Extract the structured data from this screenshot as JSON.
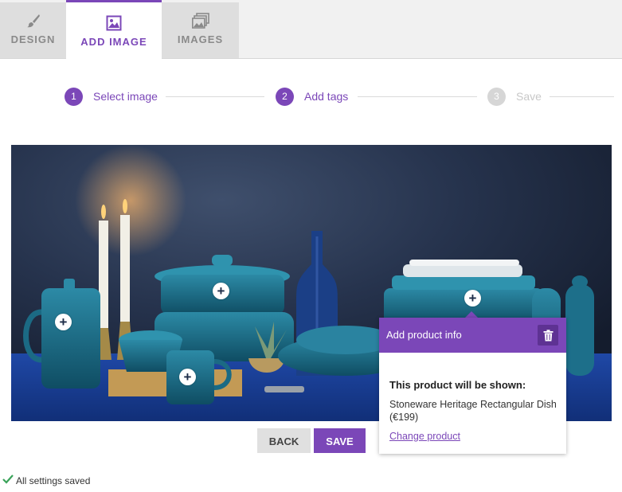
{
  "tabs": [
    {
      "label": "DESIGN",
      "icon": "brush-icon",
      "active": false
    },
    {
      "label": "ADD IMAGE",
      "icon": "image-add-icon",
      "active": true
    },
    {
      "label": "IMAGES",
      "icon": "images-stack-icon",
      "active": false
    }
  ],
  "stepper": {
    "steps": [
      {
        "number": "1",
        "label": "Select image",
        "state": "complete"
      },
      {
        "number": "2",
        "label": "Add tags",
        "state": "current"
      },
      {
        "number": "3",
        "label": "Save",
        "state": "disabled"
      }
    ]
  },
  "hero_image": {
    "subject": "cast iron cookware on a blue table with candles",
    "hotspots": [
      {
        "icon": "plus-icon",
        "symbol": "+"
      },
      {
        "icon": "plus-icon",
        "symbol": "+"
      },
      {
        "icon": "plus-icon",
        "symbol": "+"
      },
      {
        "icon": "plus-icon",
        "symbol": "+"
      }
    ]
  },
  "product_popup": {
    "title": "Add product info",
    "delete_icon": "trash-icon",
    "heading": "This product will be shown:",
    "product_name": "Stoneware Heritage Rectangular Dish (€199)",
    "change_link": "Change product"
  },
  "actions": {
    "back_label": "BACK",
    "save_label": "SAVE"
  },
  "status": {
    "icon": "check-icon",
    "text": "All settings saved"
  },
  "colors": {
    "accent": "#7b47b8",
    "accent_dark": "#5e3293",
    "step_disabled": "#d6d6d6"
  }
}
